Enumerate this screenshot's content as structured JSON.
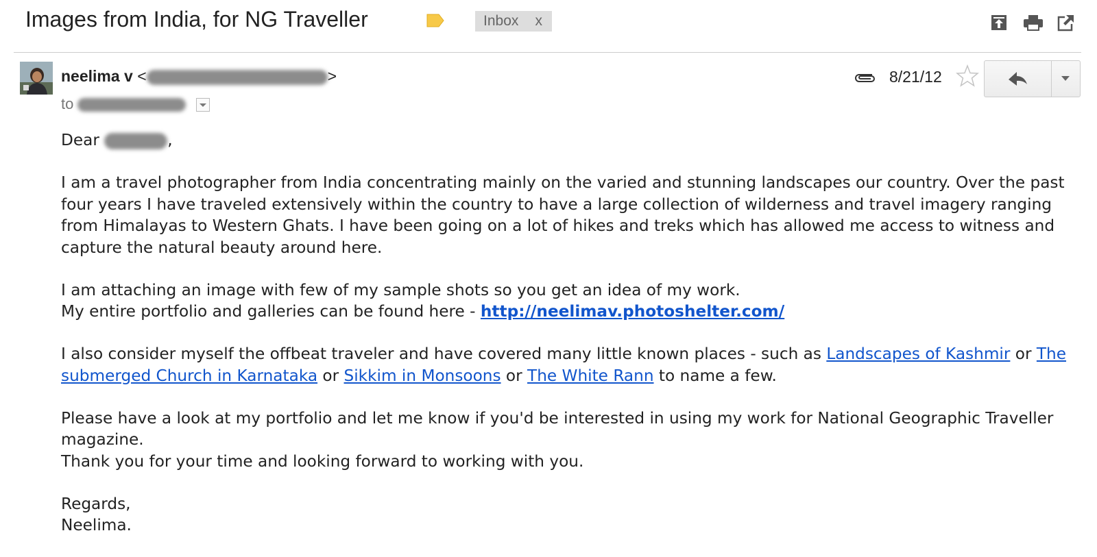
{
  "email": {
    "subject": "Images from India, for NG Traveller",
    "label": "Inbox",
    "label_remove": "x",
    "sender_name": "neelima v",
    "sender_email_prefix": "<",
    "sender_email_suffix": ">",
    "to_prefix": "to",
    "date": "8/21/12"
  },
  "body": {
    "greeting_prefix": "Dear",
    "greeting_suffix": ",",
    "p1": "I am a travel photographer from India concentrating mainly on the varied and stunning landscapes our country. Over the past four years I have traveled extensively within the country to have a large collection of wilderness and travel imagery ranging from Himalayas to Western Ghats. I have been going on a lot of hikes and treks which has allowed me access to witness and capture the natural beauty around here.",
    "p2_line1": "I am attaching an image with few of my sample shots so you get an idea of my work.",
    "p2_line2": "My entire portfolio and galleries can be found here - ",
    "portfolio_link": "http://neelimav.photoshelter.com/",
    "p3_intro": "I also consider myself the offbeat traveler and have covered many little known places - such as ",
    "link_kashmir": "Landscapes of Kashmir",
    "or": " or ",
    "link_church": "The submerged Church in Karnataka",
    "link_sikkim": "Sikkim in Monsoons",
    "link_rann": "The White Rann",
    "p3_outro": " to name a few.",
    "p4_line1": "Please have a look at my portfolio and let me know if you'd be interested in using my work for National Geographic Traveller magazine.",
    "p4_line2": "Thank you for your time and looking forward to working with you.",
    "regards": "Regards,",
    "signature": "Neelima."
  },
  "icons": {
    "label_tag": "label-tag-icon",
    "archive": "move-to-top-icon",
    "print": "print-icon",
    "new_window": "open-in-new-window-icon",
    "attachment": "paperclip-icon",
    "star": "star-icon",
    "reply": "reply-arrow-icon"
  },
  "colors": {
    "link": "#1155cc",
    "label_tag": "#f7c948",
    "chip_bg": "#dddddd"
  }
}
